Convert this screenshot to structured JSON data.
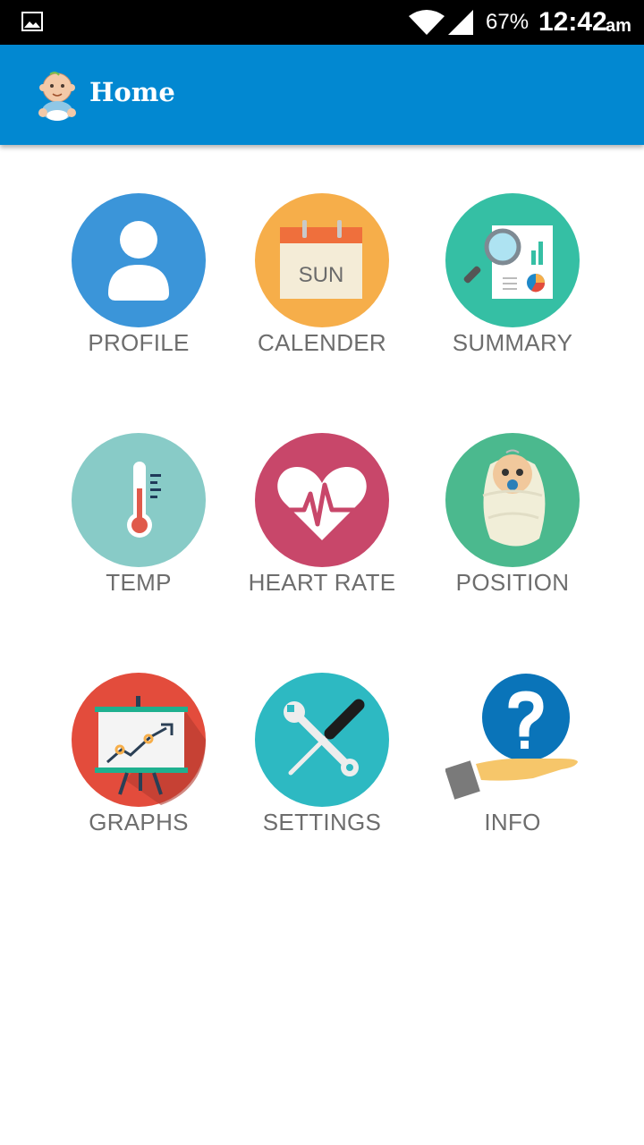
{
  "status_bar": {
    "battery": "67%",
    "time": "12:42",
    "ampm": "am"
  },
  "app_bar": {
    "title": "Home"
  },
  "menu": {
    "profile": "PROFILE",
    "calender": "CALENDER",
    "calender_day": "SUN",
    "summary": "SUMMARY",
    "temp": "TEMP",
    "heart_rate": "HEART RATE",
    "position": "POSITION",
    "graphs": "GRAPHS",
    "settings": "SETTINGS",
    "info": "INFO"
  },
  "colors": {
    "app_bar": "#0288d1",
    "profile": "#3b95d9",
    "calender": "#f6ae4a",
    "summary": "#35bfa4",
    "temp": "#88cbc7",
    "heart_rate": "#c8476a",
    "position": "#4bb98e",
    "graphs": "#e34c3c",
    "settings": "#2db9c2",
    "info": "#0a74b9"
  }
}
